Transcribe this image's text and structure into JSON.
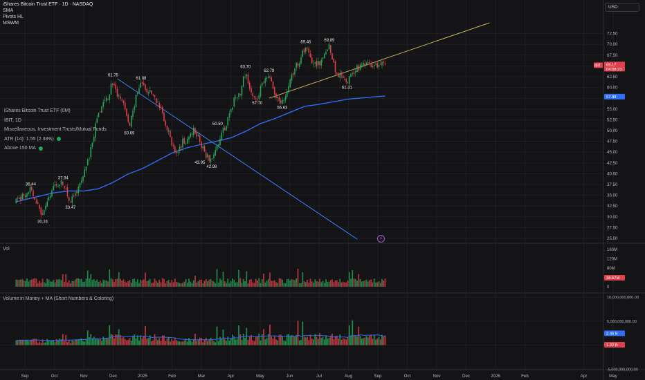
{
  "header": {
    "title": "iShares Bitcoin Trust ETF · 1D · NASDAQ",
    "indicators": [
      "SMA",
      "Pivots HL",
      "MSWM"
    ]
  },
  "currency_button": "USD",
  "info_panel": {
    "name": "iShares Bitcoin Trust ETF (0M)",
    "symbol": "IBIT, 1D",
    "category": "Miscellaneous, Investment Trusts/Mutual Funds",
    "atr": "ATR (14): 1.55 (2.38%)",
    "ma_status": "Above 150 MA"
  },
  "volume_pane": {
    "title": "Vol"
  },
  "money_pane": {
    "title": "Volume in Money + MA (Short Numbers & Coloring)"
  },
  "colors": {
    "background": "#141417",
    "bull": "#26a65b",
    "bear": "#e0404a",
    "sma": "#2f6df2",
    "trendline_down": "#3b82f6",
    "trendline_up": "#c9b25a"
  },
  "chart_data": [
    {
      "type": "candlestick",
      "title": "IBIT · 1D",
      "y_ticks": [
        72.5,
        70.0,
        67.5,
        65.0,
        62.5,
        60.0,
        57.5,
        55.0,
        52.5,
        50.0,
        47.5,
        45.0,
        42.5,
        40.0,
        37.5,
        35.0,
        32.5,
        30.0,
        27.5,
        25.0
      ],
      "y_tick_labels": [
        "72.50",
        "70.00",
        "67.50",
        "65.00",
        "62.50",
        "60.00",
        "57.50",
        "55.00",
        "52.50",
        "50.00",
        "47.50",
        "45.00",
        "42.50",
        "40.00",
        "37.50",
        "35.00",
        "32.50",
        "30.00",
        "27.50",
        "25.00"
      ],
      "ylim": [
        24.5,
        74.5
      ],
      "x_ticks": [
        "Sep",
        "Oct",
        "Nov",
        "Dec",
        "2025",
        "Feb",
        "Mar",
        "Apr",
        "May",
        "Jun",
        "Jul",
        "Aug",
        "Sep",
        "Oct",
        "Nov",
        "Dec",
        "2026",
        "Feb",
        "Apr",
        "May"
      ],
      "x_tick_months": [
        0,
        1,
        2,
        3,
        4,
        5,
        6,
        7,
        8,
        9,
        10,
        11,
        12,
        13,
        14,
        15,
        16,
        17,
        19,
        20
      ],
      "close_path": {
        "months": [
          -0.3,
          0.0,
          0.2,
          0.4,
          0.6,
          0.8,
          1.0,
          1.3,
          1.55,
          1.8,
          2.0,
          2.2,
          2.4,
          2.6,
          2.8,
          3.0,
          3.15,
          3.35,
          3.55,
          3.75,
          3.95,
          4.15,
          4.35,
          4.55,
          4.75,
          4.95,
          5.15,
          5.35,
          5.55,
          5.75,
          5.95,
          6.15,
          6.35,
          6.55,
          6.75,
          6.95,
          7.1,
          7.3,
          7.5,
          7.7,
          7.9,
          8.1,
          8.3,
          8.55,
          8.75,
          8.95,
          9.15,
          9.35,
          9.55,
          9.75,
          9.95,
          10.15,
          10.35,
          10.55,
          10.75,
          10.95,
          11.1,
          11.3,
          11.5,
          11.7,
          11.9,
          12.1,
          12.25
        ],
        "values": [
          33.5,
          35.2,
          36.44,
          33.0,
          30.24,
          34.0,
          37.0,
          37.94,
          33.47,
          36.0,
          40.0,
          44.5,
          51.0,
          55.5,
          57.5,
          61.75,
          58.0,
          56.5,
          50.69,
          57.0,
          61.08,
          59.5,
          58.0,
          56.0,
          52.5,
          48.0,
          43.95,
          47.5,
          48.0,
          50.5,
          47.5,
          44.5,
          42.98,
          46.5,
          50.0,
          53.5,
          57.0,
          58.5,
          63.7,
          58.0,
          57.7,
          61.0,
          62.79,
          57.5,
          56.63,
          60.0,
          64.0,
          66.5,
          69.46,
          66.0,
          65.5,
          66.5,
          69.89,
          64.0,
          62.5,
          61.31,
          63.0,
          64.5,
          65.17,
          65.17,
          65.17,
          65.17,
          65.17
        ]
      },
      "sma": {
        "label": "57.88",
        "months": [
          -0.3,
          0.5,
          1.0,
          1.5,
          2.0,
          2.5,
          3.0,
          3.5,
          4.0,
          4.5,
          5.0,
          5.5,
          6.0,
          6.5,
          7.0,
          7.5,
          8.0,
          8.5,
          9.0,
          9.5,
          10.0,
          10.5,
          11.0,
          11.5,
          12.0,
          12.25
        ],
        "values": [
          33.5,
          34.8,
          35.6,
          36.0,
          36.0,
          36.5,
          38.0,
          39.9,
          41.2,
          43.0,
          44.8,
          46.0,
          46.8,
          47.5,
          48.3,
          49.8,
          51.6,
          52.8,
          54.2,
          55.6,
          56.1,
          56.7,
          57.3,
          57.6,
          57.9,
          58.0
        ]
      },
      "trendlines": [
        {
          "name": "downtrend",
          "from": [
            3.15,
            62.0
          ],
          "to": [
            11.3,
            24.8
          ]
        },
        {
          "name": "uptrend",
          "from": [
            8.3,
            57.5
          ],
          "to": [
            15.8,
            75.0
          ]
        }
      ],
      "pivot_labels": [
        {
          "text": "36.44",
          "month": 0.2,
          "value": 36.44,
          "pos": "above"
        },
        {
          "text": "30.24",
          "month": 0.6,
          "value": 30.24,
          "pos": "below"
        },
        {
          "text": "37.94",
          "month": 1.3,
          "value": 37.94,
          "pos": "above"
        },
        {
          "text": "33.47",
          "month": 1.55,
          "value": 33.47,
          "pos": "below"
        },
        {
          "text": "61.75",
          "month": 3.0,
          "value": 61.75,
          "pos": "above"
        },
        {
          "text": "50.69",
          "month": 3.55,
          "value": 50.69,
          "pos": "below"
        },
        {
          "text": "61.08",
          "month": 3.95,
          "value": 61.08,
          "pos": "above"
        },
        {
          "text": "43.95",
          "month": 5.95,
          "value": 43.95,
          "pos": "below"
        },
        {
          "text": "50.50",
          "month": 6.55,
          "value": 50.5,
          "pos": "above"
        },
        {
          "text": "42.98",
          "month": 6.35,
          "value": 42.98,
          "pos": "below"
        },
        {
          "text": "63.70",
          "month": 7.5,
          "value": 63.7,
          "pos": "above"
        },
        {
          "text": "57.70",
          "month": 7.9,
          "value": 57.7,
          "pos": "below"
        },
        {
          "text": "62.79",
          "month": 8.3,
          "value": 62.79,
          "pos": "above"
        },
        {
          "text": "56.63",
          "month": 8.75,
          "value": 56.63,
          "pos": "below"
        },
        {
          "text": "69.46",
          "month": 9.55,
          "value": 69.46,
          "pos": "above"
        },
        {
          "text": "69.89",
          "month": 10.35,
          "value": 69.89,
          "pos": "above"
        },
        {
          "text": "61.31",
          "month": 10.95,
          "value": 61.31,
          "pos": "below"
        }
      ],
      "last_price": {
        "symbol": "IBIT",
        "value": 65.17,
        "label": "65.17",
        "countdown": "04:08:23"
      }
    },
    {
      "type": "bar",
      "title": "Vol",
      "y_ticks": [
        160,
        120,
        80,
        40,
        0
      ],
      "y_tick_labels": [
        "160M",
        "120M",
        "80M",
        "40M",
        "0"
      ],
      "ylim": [
        0,
        160
      ],
      "last_value_label": "38.67M"
    },
    {
      "type": "bar",
      "title": "Volume in Money + MA (Short Numbers & Coloring)",
      "y_ticks": [
        10000000000,
        5000000000,
        0,
        -5000000000
      ],
      "y_tick_labels": [
        "10,000,000,000.00",
        "5,000,000,000.00",
        "0.0000",
        "-5,000,000,000.00"
      ],
      "ylim": [
        -5000000000,
        10000000000
      ],
      "ma_label": "2.46 B",
      "last_value_label": "1.22 B"
    }
  ]
}
